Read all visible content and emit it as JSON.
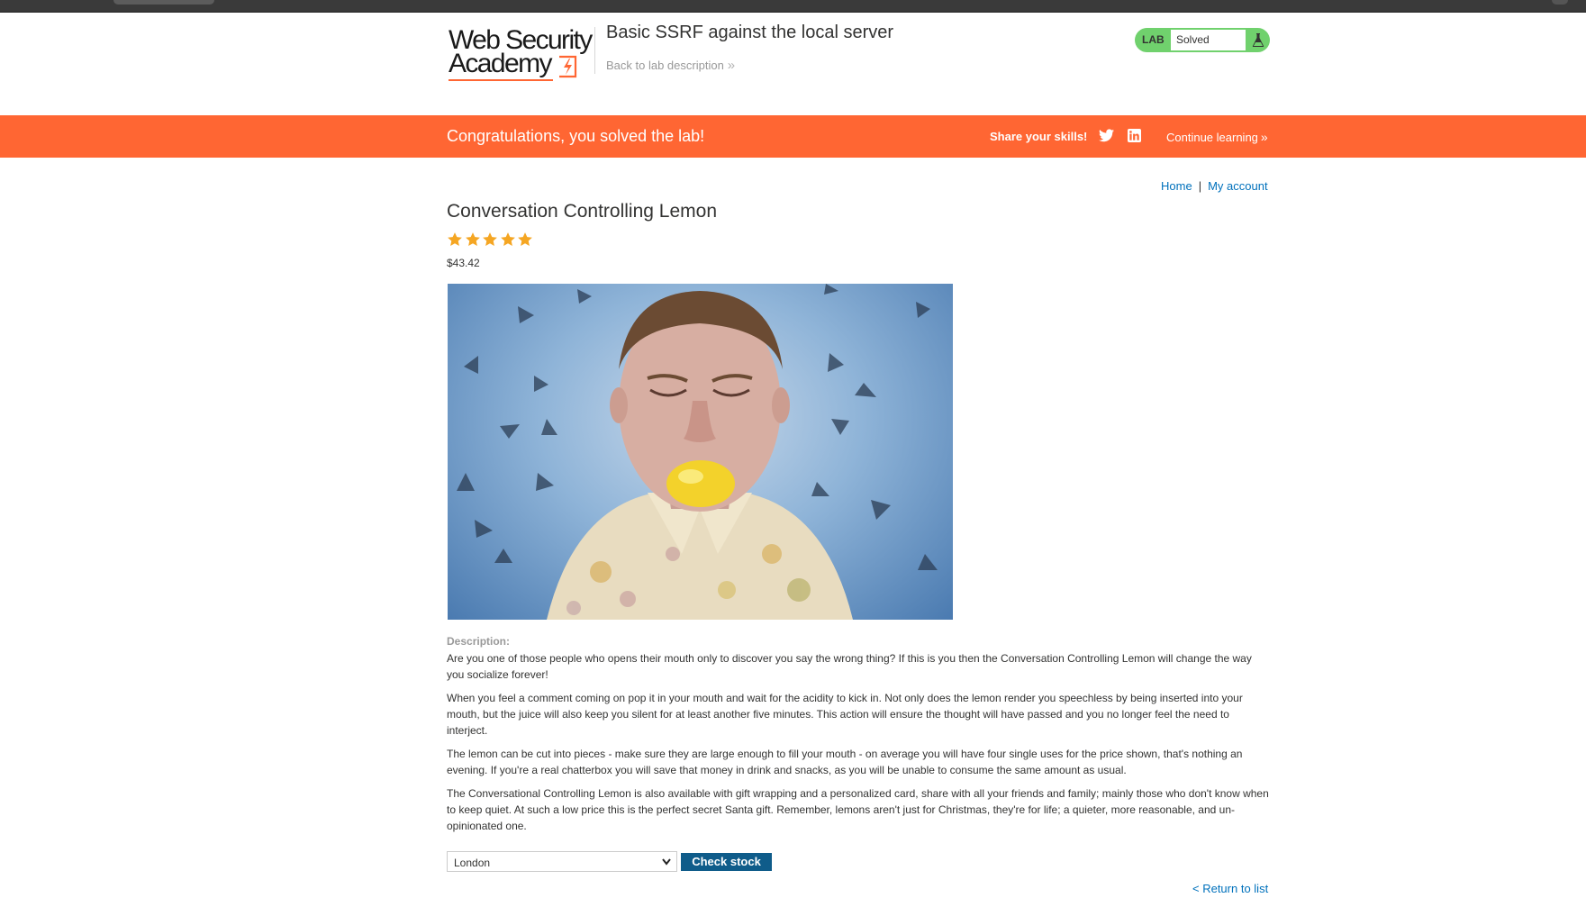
{
  "academy": {
    "logo_line1": "Web Security",
    "logo_line2": "Academy",
    "lab_title": "Basic SSRF against the local server",
    "back_link": "Back to lab description",
    "back_icon": "double-chevron-right",
    "lab_label": "LAB",
    "lab_status": "Solved",
    "status_icon": "flask-icon",
    "accent": "#ff6633",
    "solved_color": "#70d16d"
  },
  "banner": {
    "message": "Congratulations, you solved the lab!",
    "share_label": "Share your skills!",
    "share_icons": [
      "twitter-icon",
      "linkedin-icon"
    ],
    "continue_label": "Continue learning",
    "continue_icon": "double-chevron-right"
  },
  "nav": {
    "home": "Home",
    "separator": "|",
    "account": "My account"
  },
  "product": {
    "title": "Conversation Controlling Lemon",
    "rating": 5,
    "rating_max": 5,
    "star_color": "#f5a623",
    "price": "$43.42",
    "image_icon": "man-biting-lemon-photo",
    "description_label": "Description:",
    "description": [
      "Are you one of those people who opens their mouth only to discover you say the wrong thing? If this is you then the Conversation Controlling Lemon will change the way you socialize forever!",
      "When you feel a comment coming on pop it in your mouth and wait for the acidity to kick in. Not only does the lemon render you speechless by being inserted into your mouth, but the juice will also keep you silent for at least another five minutes. This action will ensure the thought will have passed and you no longer feel the need to interject.",
      "The lemon can be cut into pieces - make sure they are large enough to fill your mouth - on average you will have four single uses for the price shown, that's nothing an evening. If you're a real chatterbox you will save that money in drink and snacks, as you will be unable to consume the same amount as usual.",
      "The Conversational Controlling Lemon is also available with gift wrapping and a personalized card, share with all your friends and family; mainly those who don't know when to keep quiet. At such a low price this is the perfect secret Santa gift. Remember, lemons aren't just for Christmas, they're for life; a quieter, more reasonable, and un-opinionated one."
    ]
  },
  "stock": {
    "selected_store": "London",
    "button_label": "Check stock",
    "button_color": "#0f5c8a"
  },
  "return_link": "< Return to list",
  "link_color": "#0071bc"
}
